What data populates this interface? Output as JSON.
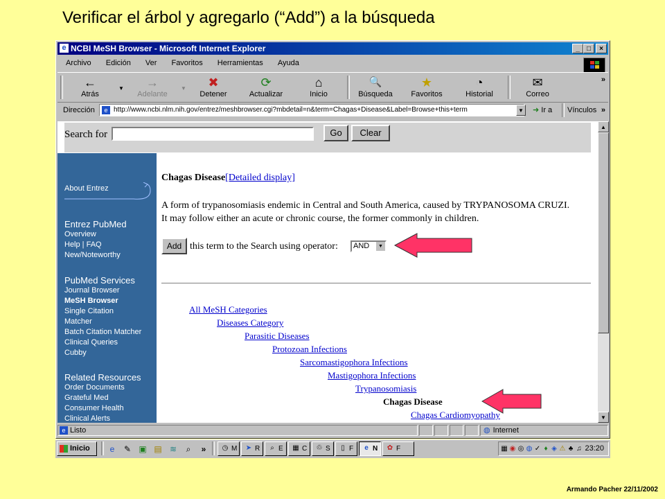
{
  "slide": {
    "title": "Verificar el árbol y agregarlo (“Add”) a la búsqueda",
    "credit": "Armando Pacher 22/11/2002"
  },
  "window": {
    "title": "NCBI MeSH Browser - Microsoft Internet Explorer",
    "controls": {
      "minimize": "_",
      "maximize": "□",
      "close": "×"
    }
  },
  "menu": [
    "Archivo",
    "Edición",
    "Ver",
    "Favoritos",
    "Herramientas",
    "Ayuda"
  ],
  "toolbar": {
    "buttons": [
      {
        "label": "Atrás",
        "icon": "←"
      },
      {
        "label": "Adelante",
        "icon": "→"
      },
      {
        "label": "Detener",
        "icon": "✖"
      },
      {
        "label": "Actualizar",
        "icon": "⟳"
      },
      {
        "label": "Inicio",
        "icon": "⌂"
      },
      {
        "label": "Búsqueda",
        "icon": "🔍"
      },
      {
        "label": "Favoritos",
        "icon": "★"
      },
      {
        "label": "Historial",
        "icon": "◔"
      },
      {
        "label": "Correo",
        "icon": "✉"
      }
    ],
    "more": "»"
  },
  "address": {
    "label": "Dirección",
    "url": "http://www.ncbi.nlm.nih.gov/entrez/meshbrowser.cgi?mbdetail=n&term=Chagas+Disease&Label=Browse+this+term",
    "go": "Ir a",
    "links": "Vínculos",
    "more": "»"
  },
  "search": {
    "label": "Search for",
    "go": "Go",
    "clear": "Clear"
  },
  "sidebar": {
    "about": "About Entrez",
    "sections": [
      {
        "head": "Entrez PubMed",
        "items": [
          "Overview",
          "Help | FAQ",
          "New/Noteworthy"
        ]
      },
      {
        "head": "PubMed Services",
        "items": [
          "Journal Browser",
          "MeSH Browser",
          "Single Citation",
          "Matcher",
          "Batch Citation Matcher",
          "Clinical Queries",
          "Cubby"
        ]
      },
      {
        "head": "Related Resources",
        "items": [
          "Order Documents",
          "Grateful Med",
          "Consumer Health",
          "Clinical Alerts"
        ]
      }
    ]
  },
  "term": {
    "name": "Chagas Disease",
    "detailed": "[Detailed display]",
    "definition": "A form of trypanosomiasis endemic in Central and South America, caused by TRYPANOSOMA CRUZI. It may follow either an acute or chronic course, the former commonly in children.",
    "add": "Add",
    "add_text": "this term to the Search using operator:",
    "operator": "AND"
  },
  "tree": [
    "All MeSH Categories",
    "Diseases Category",
    "Parasitic Diseases",
    "Protozoan Infections",
    "Sarcomastigophora Infections",
    "Mastigophora Infections",
    "Trypanosomiasis",
    "Chagas Disease",
    "Chagas Cardiomyopathy"
  ],
  "status": {
    "text": "Listo",
    "zone": "Internet"
  },
  "taskbar": {
    "start": "Inicio",
    "tasks": [
      "M",
      "R",
      "E",
      "C",
      "S",
      "F",
      "N",
      "F"
    ],
    "clock": "23:20"
  },
  "colors": {
    "desktop": "#ffff99",
    "sidebar": "#336699",
    "arrow": "#ff3366",
    "titlebar": "#000080"
  }
}
